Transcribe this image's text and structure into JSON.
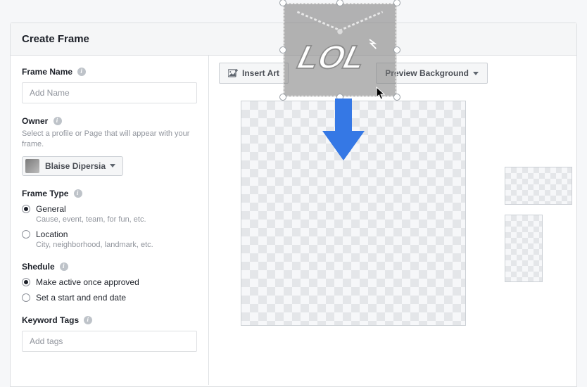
{
  "header": {
    "title": "Create Frame"
  },
  "sidebar": {
    "frame_name": {
      "label": "Frame Name",
      "placeholder": "Add Name",
      "value": ""
    },
    "owner": {
      "label": "Owner",
      "helper": "Select a profile or Page that will appear with your frame.",
      "selected": "Blaise Dipersia"
    },
    "frame_type": {
      "label": "Frame Type",
      "options": [
        {
          "label": "General",
          "desc": "Cause, event, team, for fun, etc.",
          "checked": true
        },
        {
          "label": "Location",
          "desc": "City, neighborhood, landmark, etc.",
          "checked": false
        }
      ]
    },
    "schedule": {
      "label": "Shedule",
      "options": [
        {
          "label": "Make active once approved",
          "checked": true
        },
        {
          "label": "Set a start and end date",
          "checked": false
        }
      ]
    },
    "keyword_tags": {
      "label": "Keyword Tags",
      "placeholder": "Add tags",
      "value": ""
    }
  },
  "toolbar": {
    "insert_art_label": "Insert Art",
    "preview_bg_label": "Preview Background"
  },
  "art": {
    "text": "LOL",
    "icon_name": "lol-necklace-art"
  },
  "colors": {
    "accent": "#3578e5"
  }
}
